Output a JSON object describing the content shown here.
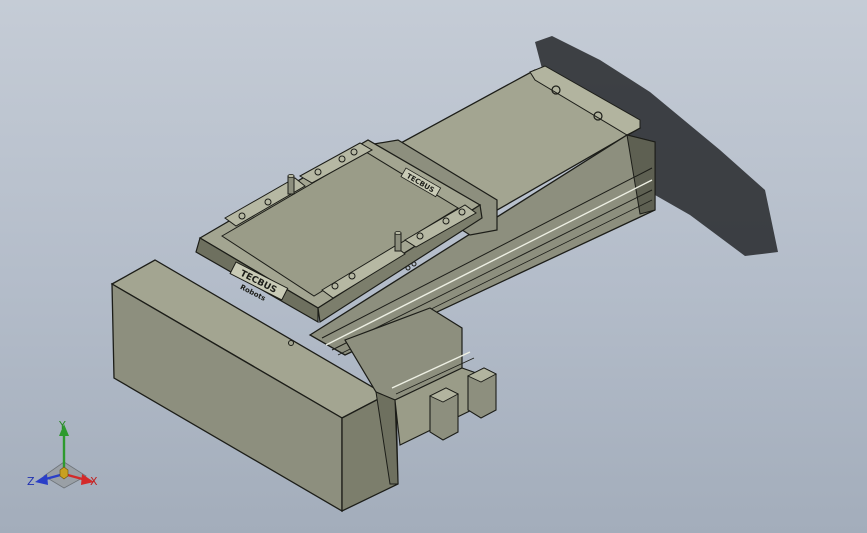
{
  "viewport": {
    "background_top": "#c5ccd6",
    "background_bottom": "#a3adbb"
  },
  "model": {
    "part_color": "#8d8f7e",
    "part_color_light": "#a3a591",
    "part_color_dark": "#5e6052",
    "edge_color": "#1c1d18",
    "shadow_color": "#2a2c30",
    "plate_label_1": "TECBUS",
    "plate_label_2": "Robots",
    "plate_label_side": "TECBUS"
  },
  "triad": {
    "axis_y": "Y",
    "axis_x": "X",
    "axis_z": "Z",
    "colors": {
      "x": "#d42a2a",
      "y": "#2e9a2e",
      "z": "#2a3fc8"
    }
  }
}
